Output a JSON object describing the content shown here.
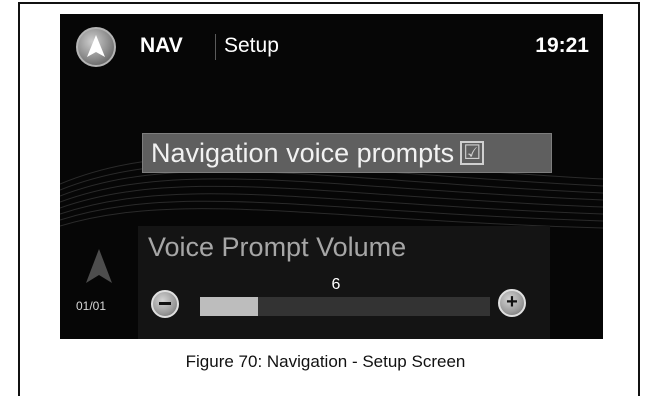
{
  "header": {
    "app_label": "NAV",
    "title": "Setup",
    "clock": "19:21",
    "logo_icon": "navigation-compass-icon"
  },
  "settings": {
    "voice_prompts": {
      "label": "Navigation voice prompts",
      "checked": true,
      "checkbox_glyph": "☑"
    },
    "voice_volume": {
      "label": "Voice Prompt Volume",
      "value": "6",
      "level_fraction": 0.2,
      "minus_icon": "minus-icon",
      "plus_icon": "plus-icon"
    }
  },
  "sidebar": {
    "direction_icon": "direction-arrow-icon",
    "page_counter": "01/01"
  },
  "caption": "Figure 70: Navigation - Setup Screen",
  "colors": {
    "screen_background": "#060606",
    "accent_gray": "#5f5f5f",
    "volume_fill": "#bdbdbd"
  }
}
